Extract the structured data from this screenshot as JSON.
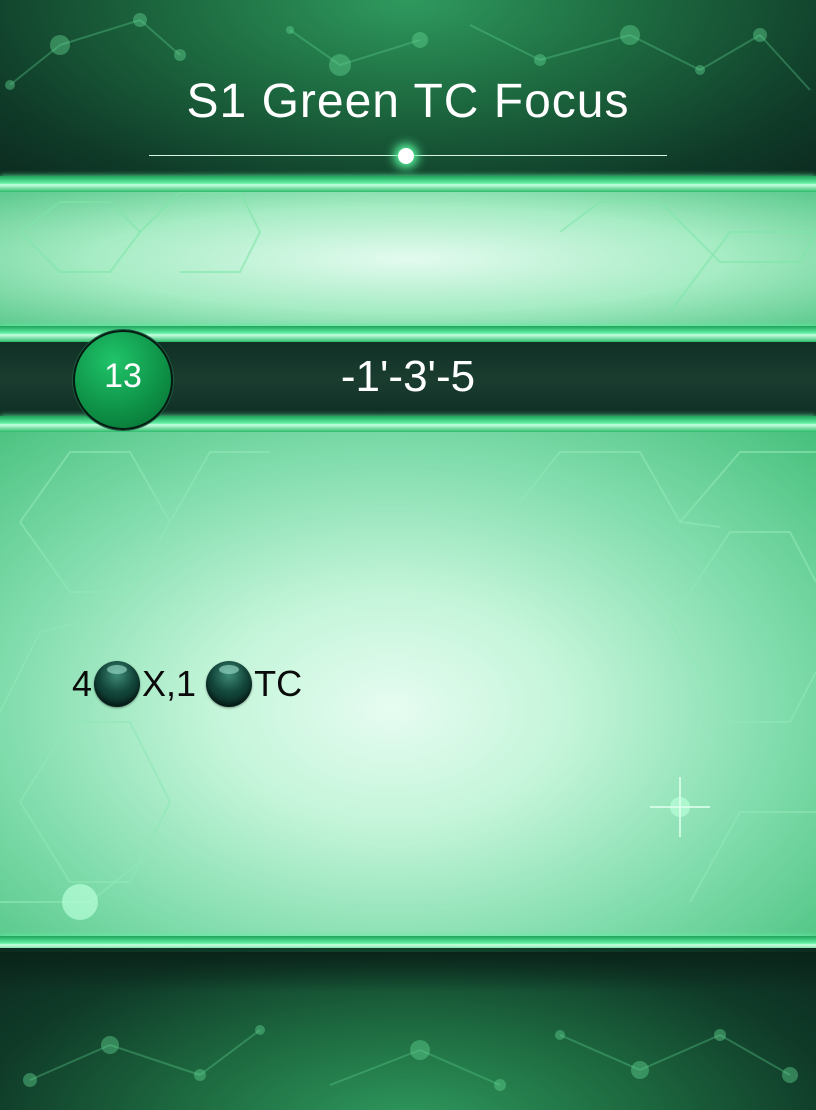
{
  "card": {
    "title": "S1 Green TC Focus",
    "level": "13",
    "cost": "-1'-3'-5",
    "effect": {
      "count_1": "4",
      "icon_1": "dark-orb-icon",
      "text_1": "X,1",
      "icon_2": "dark-orb-icon",
      "text_2": "TC"
    }
  },
  "colors": {
    "accent_green": "#1ea45a",
    "glow_green": "#64f0a6",
    "dark_band": "#0f2f24",
    "level_circle": "#0d8f45",
    "orb": "#13473b"
  }
}
